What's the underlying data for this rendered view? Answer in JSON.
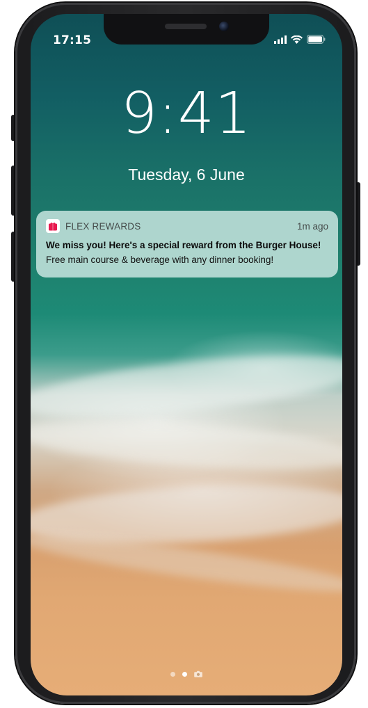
{
  "status_bar": {
    "time": "17:15",
    "icons": [
      "cellular-signal-icon",
      "wifi-icon",
      "battery-icon"
    ]
  },
  "lock_screen": {
    "clock": "9:41",
    "date": "Tuesday, 6 June"
  },
  "notification": {
    "app_icon": "gift-icon",
    "app_name": "FLEX REWARDS",
    "time": "1m ago",
    "title": "We miss you! Here's a special reward from the Burger House!",
    "body": "Free main course & beverage with any dinner booking!",
    "accent_color": "#e8194f"
  },
  "page_indicator": {
    "pages": [
      "page-dot",
      "page-dot-active",
      "camera-icon"
    ]
  }
}
